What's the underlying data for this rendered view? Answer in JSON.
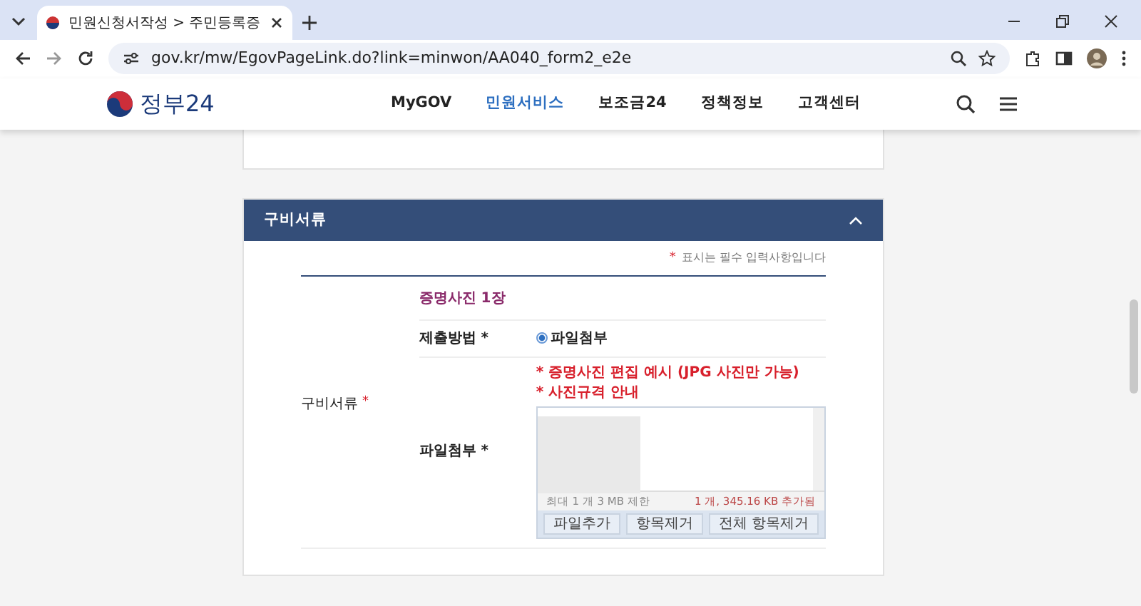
{
  "browser": {
    "tab_title": "민원신청서작성 > 주민등록증",
    "url": "gov.kr/mw/EgovPageLink.do?link=minwon/AA040_form2_e2e"
  },
  "site": {
    "logo_text": "정부24",
    "nav": [
      {
        "label": "MyGOV",
        "selected": false
      },
      {
        "label": "민원서비스",
        "selected": true
      },
      {
        "label": "보조금24",
        "selected": false
      },
      {
        "label": "정책정보",
        "selected": false
      },
      {
        "label": "고객센터",
        "selected": false
      }
    ]
  },
  "section": {
    "title": "구비서류",
    "expanded": true,
    "note_mark": "*",
    "note": "표시는 필수 입력사항입니다",
    "row_label": "구비서류",
    "row_mark": "*",
    "item_title": "증명사진 1장",
    "method": {
      "label": "제출방법 *",
      "option": "파일첨부",
      "selected": true
    },
    "attach": {
      "label": "파일첨부 *",
      "links": [
        "* 증명사진 편집 예시 (JPG 사진만 가능)",
        "* 사진규격 안내"
      ],
      "limit": "최대 1 개 3 MB 제한",
      "added": "1 개, 345.16 KB 추가됨",
      "buttons": [
        "파일추가",
        "항목제거",
        "전체 항목제거"
      ]
    }
  }
}
